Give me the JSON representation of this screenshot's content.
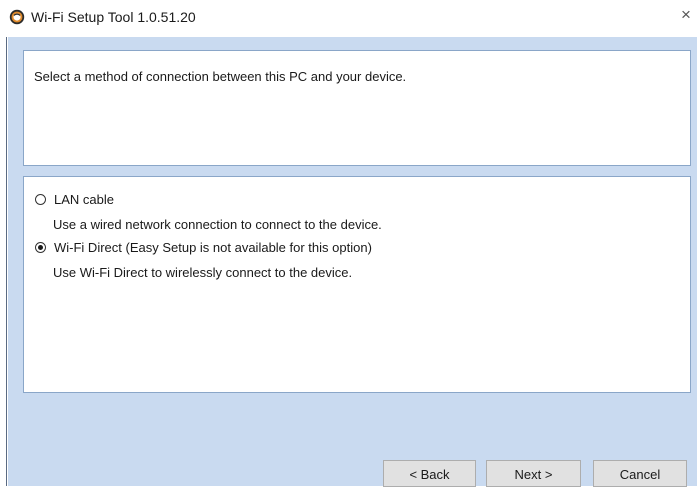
{
  "window": {
    "title": "Wi-Fi Setup Tool 1.0.51.20",
    "close_glyph": "×",
    "icon": "wifi-setup-app-icon"
  },
  "instruction": "Select a method of connection between this PC and your device.",
  "options": [
    {
      "label": "LAN cable",
      "description": "Use a wired network connection to connect to the device.",
      "selected": false
    },
    {
      "label": "Wi-Fi Direct (Easy Setup is not available for this option)",
      "description": "Use Wi-Fi Direct to wirelessly connect to the device.",
      "selected": true
    }
  ],
  "buttons": {
    "back": "< Back",
    "next": "Next >",
    "cancel": "Cancel"
  },
  "colors": {
    "client_background": "#c9daf0",
    "panel_border": "#8aa6c8",
    "button_face": "#e1e1e1"
  }
}
